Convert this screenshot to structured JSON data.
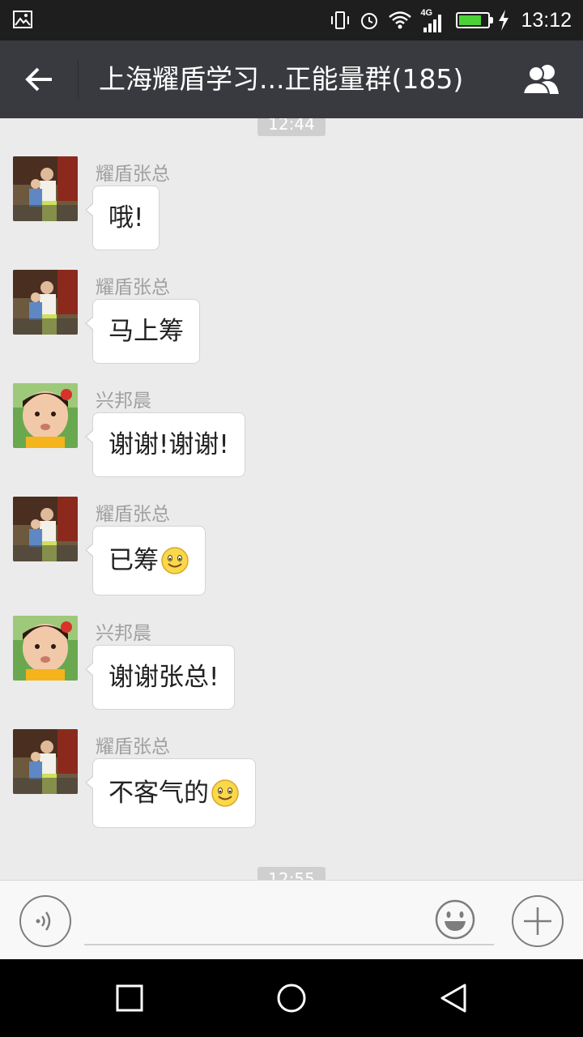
{
  "status_bar": {
    "time": "13:12",
    "network": "4G",
    "battery_level": 0.8,
    "icons": [
      "gallery-icon",
      "vibrate-icon",
      "alarm-icon",
      "wifi-icon",
      "signal-icon",
      "battery-icon",
      "charging-icon"
    ]
  },
  "header": {
    "title": "上海耀盾学习...正能量群(185)",
    "back_icon": "back-arrow-icon",
    "members_icon": "group-members-icon"
  },
  "chat": {
    "timestamps": [
      "12:44",
      "12:55"
    ],
    "messages": [
      {
        "sender": "耀盾张总",
        "text": "哦!",
        "avatar": "avatar-zhang",
        "emoji": ""
      },
      {
        "sender": "耀盾张总",
        "text": "马上筹",
        "avatar": "avatar-zhang",
        "emoji": ""
      },
      {
        "sender": "兴邦晨",
        "text": "谢谢!谢谢!",
        "avatar": "avatar-xing",
        "emoji": ""
      },
      {
        "sender": "耀盾张总",
        "text": "已筹",
        "avatar": "avatar-zhang",
        "emoji": "smile-emoji"
      },
      {
        "sender": "兴邦晨",
        "text": "谢谢张总!",
        "avatar": "avatar-xing",
        "emoji": ""
      },
      {
        "sender": "耀盾张总",
        "text": "不客气的",
        "avatar": "avatar-zhang",
        "emoji": "smile-emoji"
      }
    ]
  },
  "input_bar": {
    "text_value": "",
    "voice_icon": "voice-icon",
    "emoji_icon": "emoji-icon",
    "plus_icon": "plus-icon"
  },
  "nav_bar": {
    "icons": [
      "recent-apps-icon",
      "home-icon",
      "back-icon"
    ]
  },
  "colors": {
    "header_bg": "#393a3f",
    "status_bg": "#1e1e1e",
    "chat_bg": "#ebebeb",
    "bubble_bg": "#ffffff",
    "battery_fill": "#4cd137"
  }
}
